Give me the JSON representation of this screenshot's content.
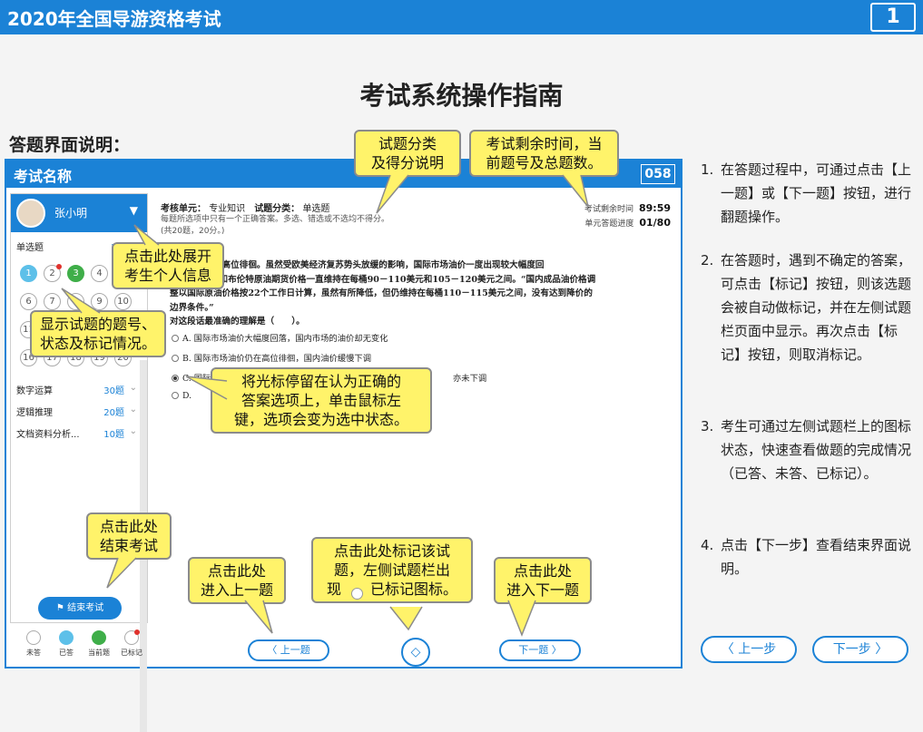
{
  "app": {
    "title": "2020年全国导游资格考试",
    "page_number": "1"
  },
  "page": {
    "title": "考试系统操作指南",
    "section_title": "答题界面说明："
  },
  "exam": {
    "name": "考试名称",
    "question_no": "058",
    "user": {
      "name": "张小明"
    },
    "sidebar": {
      "type": {
        "label": "单选题",
        "count": "20题"
      },
      "questions": [
        "1",
        "2",
        "3",
        "4",
        "5",
        "6",
        "7",
        "8",
        "9",
        "10",
        "11",
        "12",
        "13",
        "14",
        "15",
        "16",
        "17",
        "18",
        "19",
        "20"
      ],
      "sections": [
        {
          "label": "数字运算",
          "count": "30题"
        },
        {
          "label": "逻辑推理",
          "count": "20题"
        },
        {
          "label": "文档资料分析...",
          "count": "10题"
        }
      ],
      "end_button": "结束考试"
    },
    "legend": [
      "未答",
      "已答",
      "当前题",
      "已标记"
    ],
    "header": {
      "unit_label": "考核单元：",
      "unit_value": "专业知识",
      "category_label": "试题分类：",
      "category_value": "单选题",
      "note": "每题所选项中只有一个正确答案。多选、错选或不选均不得分。",
      "note2": "(共20题，20分。)",
      "time_label": "考试剩余时间",
      "time_value": "89:59",
      "progress_label": "单元答题进度",
      "progress_value": "01/80"
    },
    "question": {
      "lines": [
        "国际市场油价高位徘徊。虽然受欧美经济复苏势头放缓的影响，国际市场油价一度出现较大幅度回",
        "落，但 WTI和布伦特原油期货价格一直维持在每桶90－110美元和105－120美元之间。“国内成品油价格调",
        "整以国际原油价格按22个工作日计算，虽然有所降低，但仍维持在每桶110－115美元之间，没有达到降价的",
        "边界条件。”",
        "对这段话最准确的理解是（　　）。"
      ],
      "options": [
        {
          "label": "A.",
          "text": "国际市场油价大幅度回落，国内市场的油价却无变化"
        },
        {
          "label": "B.",
          "text": "国际市场油价仍在高位徘徊，国内油价缓慢下调"
        },
        {
          "label": "C.",
          "text": "国际",
          "tail": "亦未下调"
        },
        {
          "label": "D.",
          "text": ""
        }
      ]
    },
    "nav": {
      "prev": "上一题",
      "next": "下一题"
    }
  },
  "callouts": {
    "category": "试题分类\n及得分说明",
    "time": "考试剩余时间，当\n前题号及总题数。",
    "user": "点击此处展开\n考生个人信息",
    "grid": "显示试题的题号、\n状态及标记情况。",
    "answer": "将光标停留在认为正确的\n答案选项上，单击鼠标左\n键，选项会变为选中状态。",
    "end": "点击此处\n结束考试",
    "prev": "点击此处\n进入上一题",
    "mark": "点击此处标记该试\n题，左侧试题栏出\n现　　已标记图标。",
    "next": "点击此处\n进入下一题"
  },
  "instructions": [
    {
      "n": "1.",
      "text": "在答题过程中，可通过点击【上一题】或【下一题】按钮，进行翻题操作。"
    },
    {
      "n": "2.",
      "text": "在答题时，遇到不确定的答案，可点击【标记】按钮，则该选题会被自动做标记，并在左侧试题栏页面中显示。再次点击【标记】按钮，则取消标记。"
    },
    {
      "n": "3.",
      "text": "考生可通过左侧试题栏上的图标状态，快速查看做题的完成情况（已答、未答、已标记）。"
    },
    {
      "n": "4.",
      "text": "点击【下一步】查看结束界面说明。"
    }
  ],
  "footer": {
    "prev_step": "上一步",
    "next_step": "下一步"
  }
}
